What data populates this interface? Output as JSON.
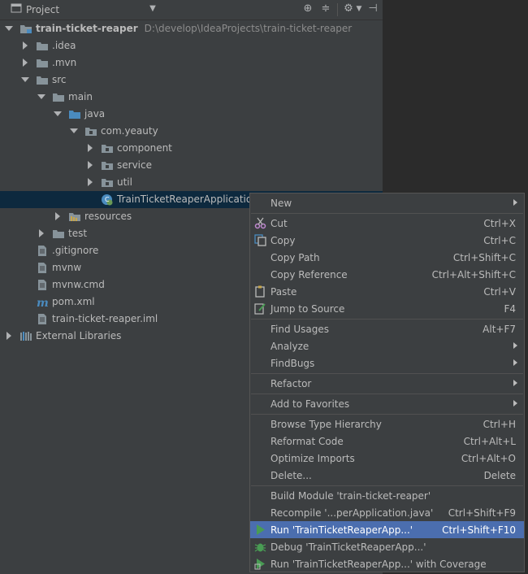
{
  "header": {
    "title": "Project",
    "icons": [
      "project-view-icon",
      "dropdown-icon",
      "locate-icon",
      "collapse-all-icon",
      "settings-icon",
      "hide-icon"
    ]
  },
  "tree": {
    "rows": [
      {
        "label": "train-ticket-reaper",
        "path": "D:\\develop\\IdeaProjects\\train-ticket-reaper",
        "icon": "module-folder-icon"
      },
      {
        "label": ".idea",
        "icon": "folder-icon"
      },
      {
        "label": ".mvn",
        "icon": "folder-icon"
      },
      {
        "label": "src",
        "icon": "folder-icon"
      },
      {
        "label": "main",
        "icon": "folder-icon"
      },
      {
        "label": "java",
        "icon": "source-folder-icon"
      },
      {
        "label": "com.yeauty",
        "icon": "package-icon"
      },
      {
        "label": "component",
        "icon": "package-icon"
      },
      {
        "label": "service",
        "icon": "package-icon"
      },
      {
        "label": "util",
        "icon": "package-icon"
      },
      {
        "label": "TrainTicketReaperApplicatio",
        "icon": "spring-boot-class-icon"
      },
      {
        "label": "resources",
        "icon": "resources-folder-icon"
      },
      {
        "label": "test",
        "icon": "folder-icon"
      },
      {
        "label": ".gitignore",
        "icon": "file-icon"
      },
      {
        "label": "mvnw",
        "icon": "file-icon"
      },
      {
        "label": "mvnw.cmd",
        "icon": "file-icon"
      },
      {
        "label": "pom.xml",
        "icon": "maven-icon"
      },
      {
        "label": "train-ticket-reaper.iml",
        "icon": "file-icon"
      },
      {
        "label": "External Libraries",
        "icon": "libraries-icon"
      }
    ]
  },
  "menu": {
    "items": [
      {
        "label": "New",
        "shortcut": ""
      },
      {
        "label": "Cut",
        "shortcut": "Ctrl+X",
        "icon": "cut-icon"
      },
      {
        "label": "Copy",
        "shortcut": "Ctrl+C",
        "icon": "copy-icon"
      },
      {
        "label": "Copy Path",
        "shortcut": "Ctrl+Shift+C"
      },
      {
        "label": "Copy Reference",
        "shortcut": "Ctrl+Alt+Shift+C"
      },
      {
        "label": "Paste",
        "shortcut": "Ctrl+V",
        "icon": "paste-icon"
      },
      {
        "label": "Jump to Source",
        "shortcut": "F4",
        "icon": "jump-to-source-icon"
      },
      {
        "label": "Find Usages",
        "shortcut": "Alt+F7"
      },
      {
        "label": "Analyze",
        "shortcut": ""
      },
      {
        "label": "FindBugs",
        "shortcut": ""
      },
      {
        "label": "Refactor",
        "shortcut": ""
      },
      {
        "label": "Add to Favorites",
        "shortcut": ""
      },
      {
        "label": "Browse Type Hierarchy",
        "shortcut": "Ctrl+H"
      },
      {
        "label": "Reformat Code",
        "shortcut": "Ctrl+Alt+L"
      },
      {
        "label": "Optimize Imports",
        "shortcut": "Ctrl+Alt+O"
      },
      {
        "label": "Delete...",
        "shortcut": "Delete"
      },
      {
        "label": "Build Module 'train-ticket-reaper'",
        "shortcut": ""
      },
      {
        "label": "Recompile '...perApplication.java'",
        "shortcut": "Ctrl+Shift+F9"
      },
      {
        "label": "Run 'TrainTicketReaperApp...'",
        "shortcut": "Ctrl+Shift+F10",
        "icon": "run-icon"
      },
      {
        "label": "Debug 'TrainTicketReaperApp...'",
        "shortcut": "",
        "icon": "debug-icon"
      },
      {
        "label": "Run 'TrainTicketReaperApp...' with Coverage",
        "shortcut": "",
        "icon": "coverage-icon"
      }
    ]
  },
  "colors": {
    "panel_bg": "#3c3f41",
    "editor_bg": "#2b2b2b",
    "selection_bg": "#0d293e",
    "menu_highlight": "#4b6eaf",
    "folder": "#87939a",
    "source_folder": "#4a8bbf",
    "run_green": "#499c54"
  }
}
